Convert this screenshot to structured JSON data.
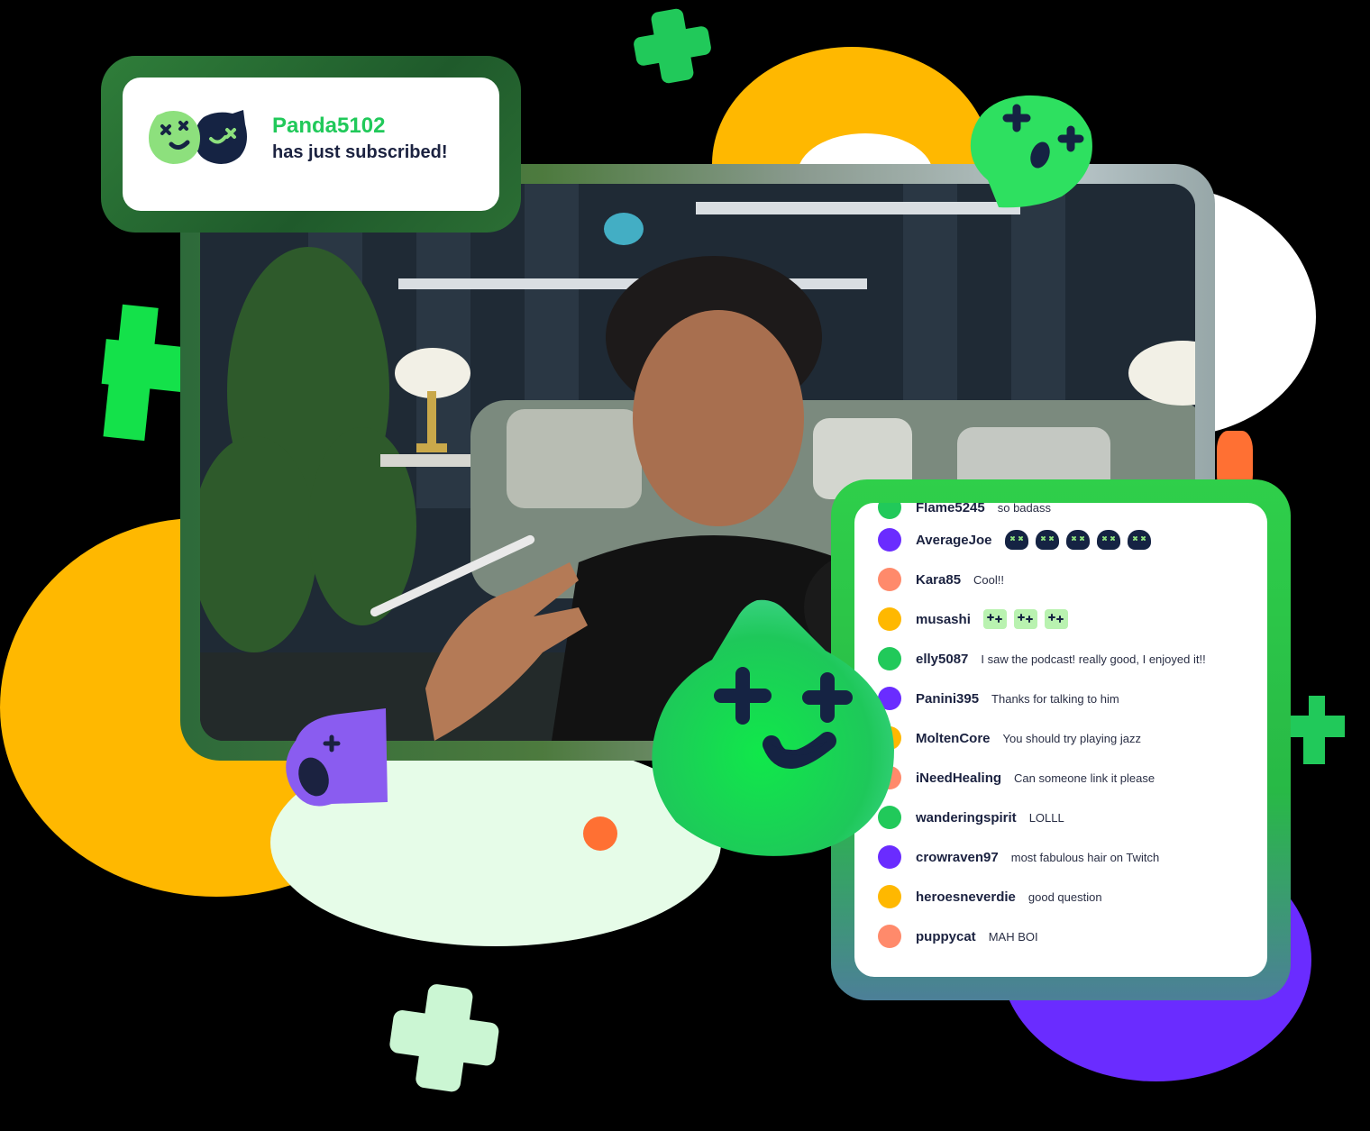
{
  "colors": {
    "accent_green": "#21c95a",
    "bright_green": "#14e14a",
    "yellow": "#ffb800",
    "purple": "#6a2cff",
    "orange": "#ff7033",
    "navy": "#152343",
    "light_green": "#e6fce8"
  },
  "notification": {
    "username": "Panda5102",
    "message": "has just subscribed!",
    "icon": "mascot-pair-icon"
  },
  "chat": {
    "partial_row": {
      "user": "Flame5245",
      "msg": "so badass"
    },
    "messages": [
      {
        "user": "AverageJoe",
        "msg": "",
        "avatar": "#6a2cff",
        "emotes": 5,
        "emote_style": "navy"
      },
      {
        "user": "Kara85",
        "msg": "Cool!!",
        "avatar": "#ff8a6b",
        "emotes": 0
      },
      {
        "user": "musashi",
        "msg": "",
        "avatar": "#ffb800",
        "emotes": 3,
        "emote_style": "lightgreen"
      },
      {
        "user": "elly5087",
        "msg": "I saw the podcast! really good, I enjoyed it!!",
        "avatar": "#21c95a",
        "emotes": 0
      },
      {
        "user": "Panini395",
        "msg": "Thanks for talking to him",
        "avatar": "#6a2cff",
        "emotes": 0
      },
      {
        "user": "MoltenCore",
        "msg": "You should try playing jazz",
        "avatar": "#ffb800",
        "emotes": 0
      },
      {
        "user": "iNeedHealing",
        "msg": "Can someone link it please",
        "avatar": "#ff8a6b",
        "emotes": 0
      },
      {
        "user": "wanderingspirit",
        "msg": "LOLLL",
        "avatar": "#21c95a",
        "emotes": 0
      },
      {
        "user": "crowraven97",
        "msg": "most fabulous hair on Twitch",
        "avatar": "#6a2cff",
        "emotes": 0
      },
      {
        "user": "heroesneverdie",
        "msg": "good question",
        "avatar": "#ffb800",
        "emotes": 0
      },
      {
        "user": "puppycat",
        "msg": "MAH BOI",
        "avatar": "#ff8a6b",
        "emotes": 0
      }
    ]
  },
  "icons": {
    "mascot_big": "happy-green-mascot-icon",
    "mascot_surprised": "surprised-green-mascot-icon",
    "mascot_purple": "purple-mascot-icon"
  }
}
